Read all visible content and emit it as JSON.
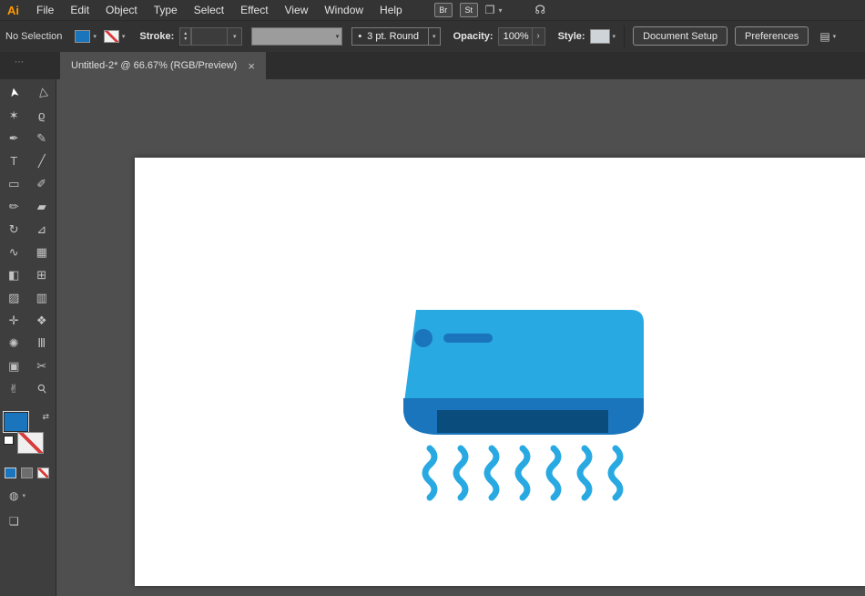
{
  "theme": {
    "--ui-fill": "#1B75BC",
    "--ac-body": "#29A9E2",
    "--ac-accent": "#1B75BC",
    "--ac-vent": "#0A4C7C"
  },
  "menubar": {
    "logo": "Ai",
    "items": [
      "File",
      "Edit",
      "Object",
      "Type",
      "Select",
      "Effect",
      "View",
      "Window",
      "Help"
    ],
    "bridge_badge": "Br",
    "stock_badge": "St",
    "workspace_icon": "❐",
    "workspace_arrow": "▾",
    "share_icon": "☊"
  },
  "controlbar": {
    "selection_status": "No Selection",
    "fill_arrow": "▾",
    "stroke_arrow": "▾",
    "stroke_label": "Stroke:",
    "stepper_up": "▴",
    "stepper_down": "▾",
    "weight_arrow": "▾",
    "brush_arrow": "▾",
    "round_bullet": "•",
    "round_label": "3 pt. Round",
    "round_arrow": "▾",
    "opacity_label": "Opacity:",
    "opacity_value": "100%",
    "opacity_chevron": "›",
    "style_label": "Style:",
    "style_arrow": "▾",
    "document_setup": "Document Setup",
    "preferences": "Preferences",
    "panel_icon": "▤",
    "panel_arrow": "▾"
  },
  "tabbar": {
    "grip": "⋯",
    "title": "Untitled-2* @ 66.67% (RGB/Preview)",
    "close": "×"
  },
  "toolbar": {
    "tools": [
      {
        "id": "selection-tool",
        "glyph": "➤"
      },
      {
        "id": "direct-selection-tool",
        "glyph": "▷"
      },
      {
        "id": "magic-wand-tool",
        "glyph": "✶"
      },
      {
        "id": "lasso-tool",
        "glyph": "ϱ"
      },
      {
        "id": "pen-tool",
        "glyph": "✒"
      },
      {
        "id": "curvature-tool",
        "glyph": "✎"
      },
      {
        "id": "type-tool",
        "glyph": "T"
      },
      {
        "id": "line-segment-tool",
        "glyph": "╱"
      },
      {
        "id": "rectangle-tool",
        "glyph": "▭"
      },
      {
        "id": "paintbrush-tool",
        "glyph": "✐"
      },
      {
        "id": "shaper-tool",
        "glyph": "✏"
      },
      {
        "id": "eraser-tool",
        "glyph": "▰"
      },
      {
        "id": "rotate-tool",
        "glyph": "↻"
      },
      {
        "id": "scale-tool",
        "glyph": "⊿"
      },
      {
        "id": "width-tool",
        "glyph": "∿"
      },
      {
        "id": "free-transform-tool",
        "glyph": "▦"
      },
      {
        "id": "shape-builder-tool",
        "glyph": "◧"
      },
      {
        "id": "perspective-grid-tool",
        "glyph": "⊞"
      },
      {
        "id": "mesh-tool",
        "glyph": "▨"
      },
      {
        "id": "gradient-tool",
        "glyph": "▥"
      },
      {
        "id": "eyedropper-tool",
        "glyph": "✛"
      },
      {
        "id": "blend-tool",
        "glyph": "❖"
      },
      {
        "id": "symbol-sprayer-tool",
        "glyph": "✺"
      },
      {
        "id": "column-graph-tool",
        "glyph": "Ⅲ"
      },
      {
        "id": "artboard-tool",
        "glyph": "▣"
      },
      {
        "id": "slice-tool",
        "glyph": "✂"
      },
      {
        "id": "hand-tool",
        "glyph": "✌"
      },
      {
        "id": "zoom-tool",
        "glyph": "⚲"
      }
    ],
    "swap_icon": "⇄",
    "draw_mode_icon": "◍",
    "draw_mode_arrow": "▾",
    "screen_mode_icon": "❏"
  },
  "artwork": {
    "name": "air-conditioner-icon",
    "air_lines": 7,
    "colors": {
      "body": "#29A9E2",
      "accent": "#1B75BC",
      "vent": "#0A4C7C"
    }
  }
}
